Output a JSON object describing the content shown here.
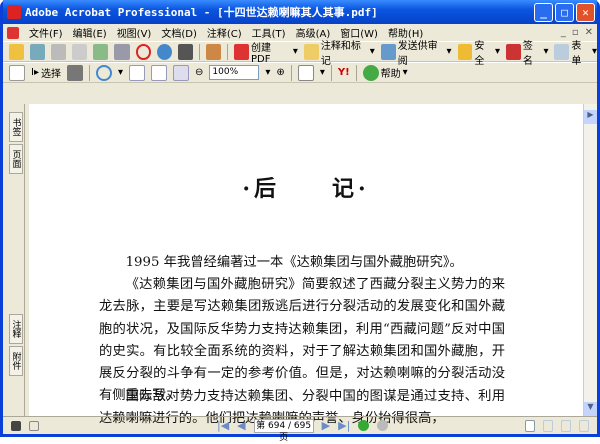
{
  "window": {
    "title": "Adobe Acrobat Professional - [十四世达赖喇嘛其人其事.pdf]"
  },
  "menu": [
    "文件(F)",
    "编辑(E)",
    "视图(V)",
    "文档(D)",
    "注释(C)",
    "工具(T)",
    "高级(A)",
    "窗口(W)",
    "帮助(H)"
  ],
  "toolbar1": {
    "create_pdf": "创建 PDF",
    "comment": "注释和标记",
    "review": "发送供审阅",
    "secure": "安全",
    "sign": "签名",
    "forms": "表单"
  },
  "toolbar2": {
    "select": "选择",
    "zoom": "100%",
    "help": "帮助"
  },
  "side_tabs": {
    "top": [
      "书签",
      "页面"
    ],
    "bottom": [
      "注释",
      "附件"
    ]
  },
  "document": {
    "heading": "·后　　记·",
    "paragraphs": [
      "1995 年我曾经编著过一本《达赖集团与国外藏胞研究》。",
      "《达赖集团与国外藏胞研究》简要叙述了西藏分裂主义势力的来龙去脉，主要是写达赖集团叛逃后进行分裂活动的发展变化和国外藏胞的状况，及国际反华势力支持达赖集团，利用“西藏问题”反对中国的史实。有比较全面系统的资料，对于了解达赖集团和国外藏胞，开展反分裂的斗争有一定的参考价值。但是，对达赖喇嘛的分裂活动没有侧重去写。",
      "国际敌对势力支持达赖集团、分裂中国的图谋是通过支持、利用达赖喇嘛进行的。他们把达赖喇嘛的声誉、身份抬得很高，"
    ]
  },
  "status": {
    "page": "第 694 / 695 页"
  }
}
